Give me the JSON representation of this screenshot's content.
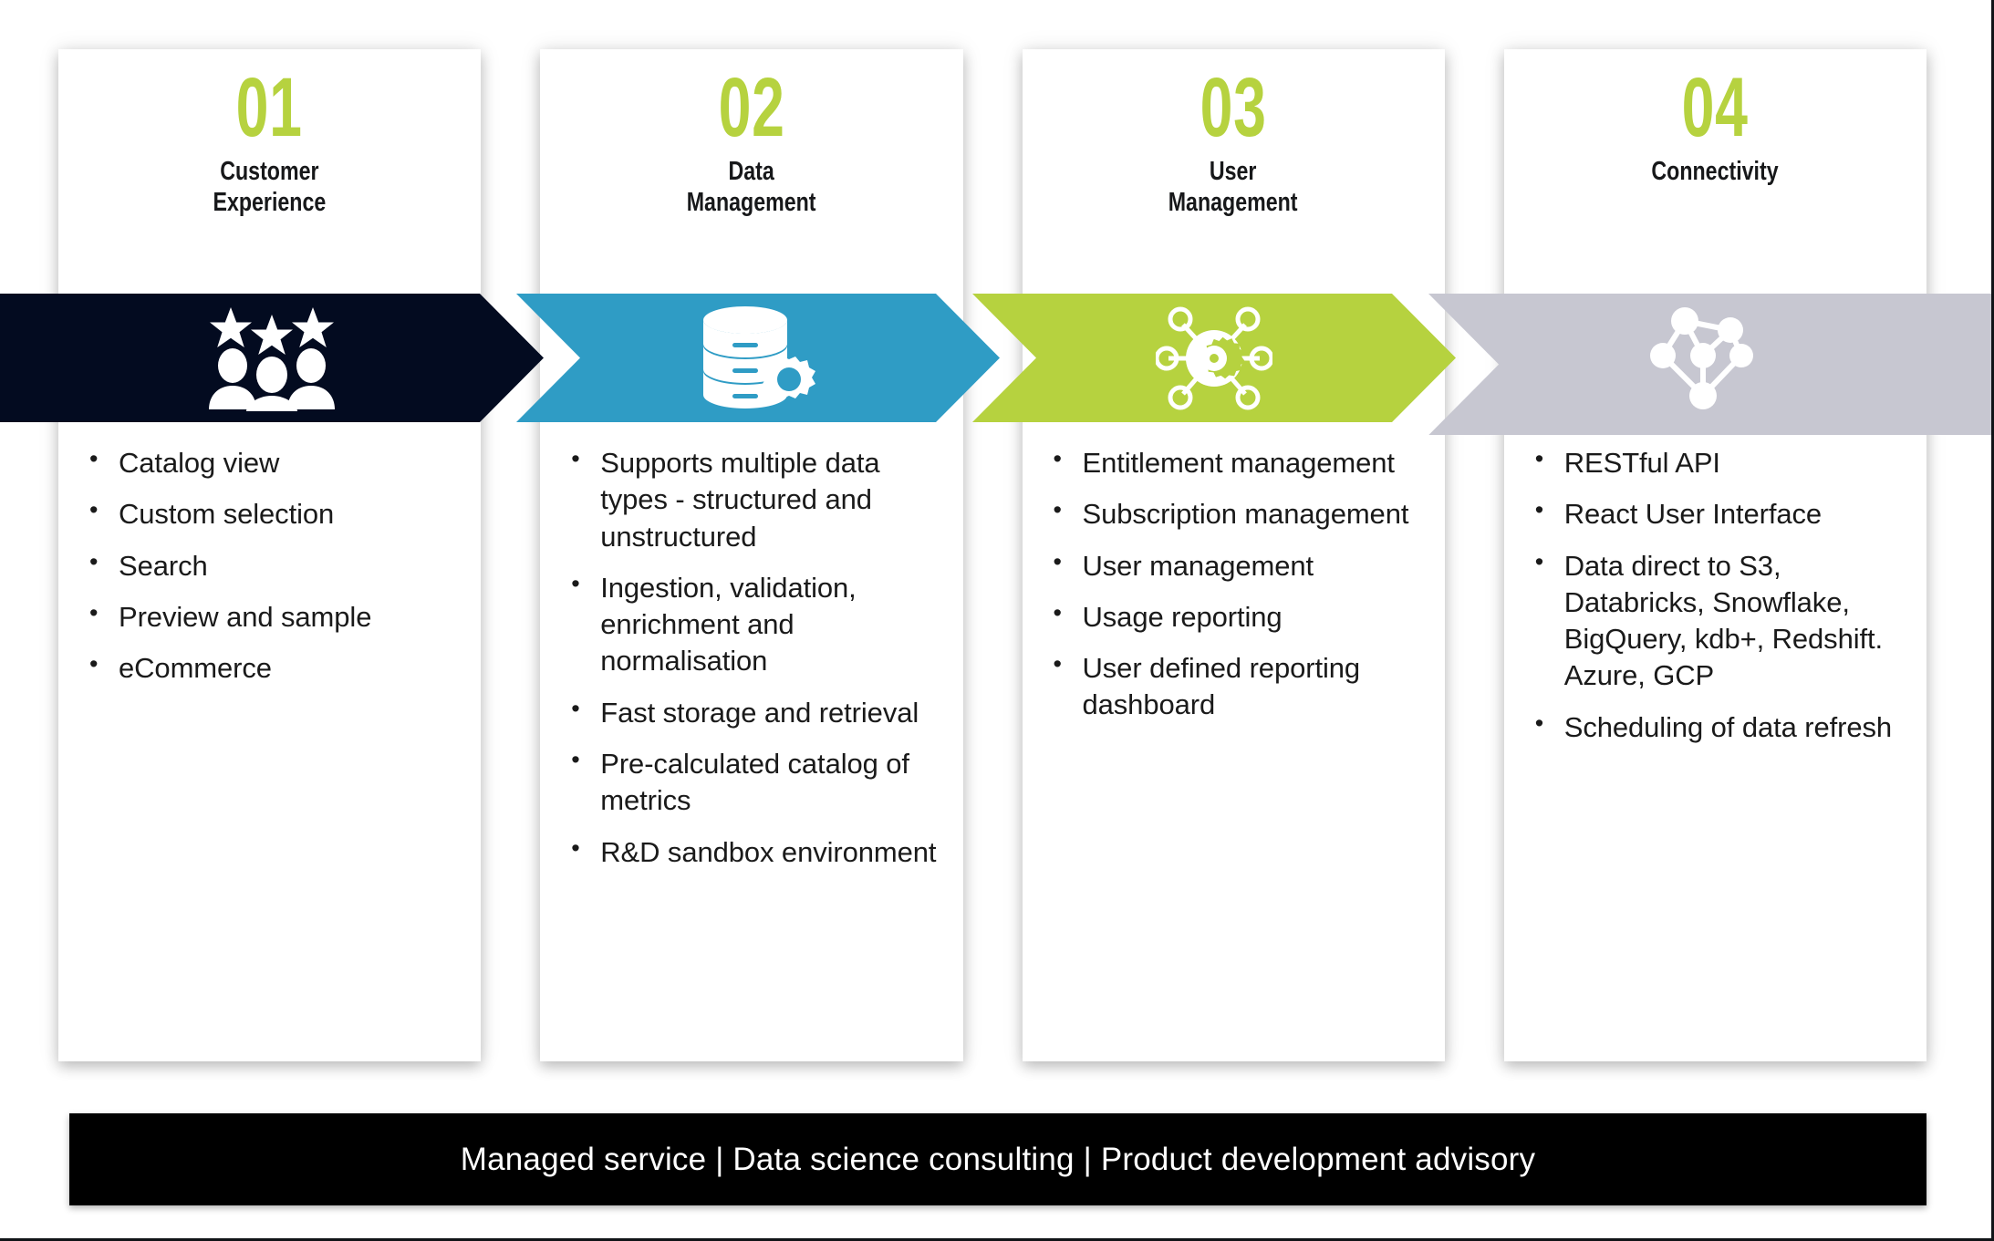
{
  "slide": {
    "footer_text": "Managed service | Data science consulting | Product development advisory"
  },
  "colors": {
    "accent_green": "#b6d23f",
    "navy": "#030b20",
    "blue": "#2f9cc5",
    "green_band": "#b6d23f",
    "grey_band": "#c7c7d1",
    "footer_black": "#000000",
    "text_dark": "#1a1a1a"
  },
  "columns": [
    {
      "number": "01",
      "title": "Customer\nExperience",
      "icon": "customer-rating-group-icon",
      "band_color": "#030b20",
      "bullets": [
        "Catalog view",
        "Custom selection",
        "Search",
        "Preview and sample",
        "eCommerce"
      ]
    },
    {
      "number": "02",
      "title": "Data\nManagement",
      "icon": "database-gear-icon",
      "band_color": "#2f9cc5",
      "bullets": [
        "Supports multiple data types - structured and unstructured",
        "Ingestion, validation, enrichment and normalisation",
        "Fast storage and retrieval",
        "Pre-calculated catalog of metrics",
        "R&D sandbox environment"
      ]
    },
    {
      "number": "03",
      "title": "User\nManagement",
      "icon": "gear-network-hub-icon",
      "band_color": "#b6d23f",
      "bullets": [
        "Entitlement management",
        "Subscription management",
        "User management",
        "Usage reporting",
        "User defined reporting dashboard"
      ]
    },
    {
      "number": "04",
      "title": "Connectivity",
      "icon": "network-mesh-icon",
      "band_color": "#c7c7d1",
      "bullets": [
        "RESTful API",
        "React User Interface",
        "Data direct to S3, Databricks, Snowflake, BigQuery, kdb+, Redshift. Azure, GCP",
        "Scheduling of data refresh"
      ]
    }
  ]
}
